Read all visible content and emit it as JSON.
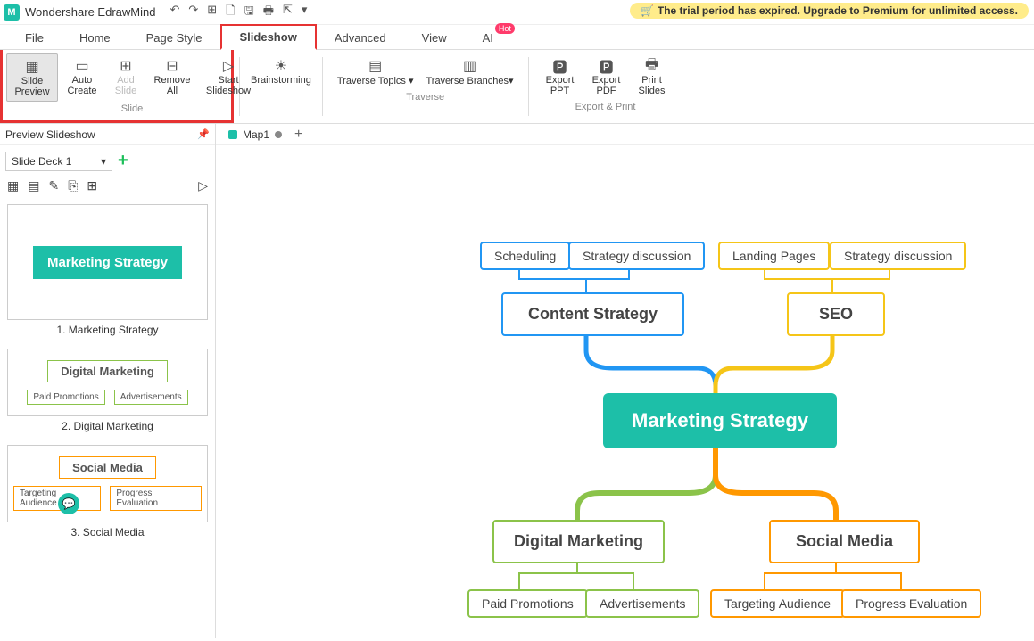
{
  "app": {
    "name": "Wondershare EdrawMind",
    "trial_message": "The trial period has expired. Upgrade to Premium for unlimited access."
  },
  "qat": {
    "undo": "↶",
    "redo": "↷",
    "new": "⊞",
    "open": "🗋",
    "save": "🖫",
    "print": "🖶",
    "export": "⇱",
    "dd": "▾"
  },
  "menu": {
    "file": "File",
    "home": "Home",
    "page_style": "Page Style",
    "slideshow": "Slideshow",
    "advanced": "Advanced",
    "view": "View",
    "ai": "AI",
    "hot": "Hot"
  },
  "ribbon": {
    "slide_preview": "Slide Preview",
    "auto_create": "Auto Create",
    "add_slide": "Add Slide",
    "remove_all": "Remove All",
    "start_slideshow": "Start Slideshow",
    "brainstorming": "Brainstorming",
    "traverse_topics": "Traverse Topics",
    "traverse_branches": "Traverse Branches",
    "export_ppt": "Export PPT",
    "export_pdf": "Export PDF",
    "print_slides": "Print Slides",
    "group_slide": "Slide",
    "group_traverse": "Traverse",
    "group_export": "Export & Print"
  },
  "panel": {
    "title": "Preview Slideshow",
    "deck": "Slide Deck 1",
    "slides": [
      {
        "caption": "1. Marketing Strategy",
        "title": "Marketing Strategy"
      },
      {
        "caption": "2. Digital Marketing",
        "title": "Digital Marketing",
        "c1": "Paid Promotions",
        "c2": "Advertisements"
      },
      {
        "caption": "3. Social Media",
        "title": "Social Media",
        "c1": "Targeting Audience",
        "c2": "Progress Evaluation"
      }
    ]
  },
  "tabs": {
    "doc": "Map1",
    "add": "+"
  },
  "mindmap": {
    "center": "Marketing Strategy",
    "content_strategy": "Content Strategy",
    "scheduling": "Scheduling",
    "strategy_discussion1": "Strategy discussion",
    "seo": "SEO",
    "landing_pages": "Landing Pages",
    "strategy_discussion2": "Strategy discussion",
    "digital_marketing": "Digital Marketing",
    "paid_promotions": "Paid Promotions",
    "advertisements": "Advertisements",
    "social_media": "Social Media",
    "targeting_audience": "Targeting Audience",
    "progress_evaluation": "Progress Evaluation"
  }
}
